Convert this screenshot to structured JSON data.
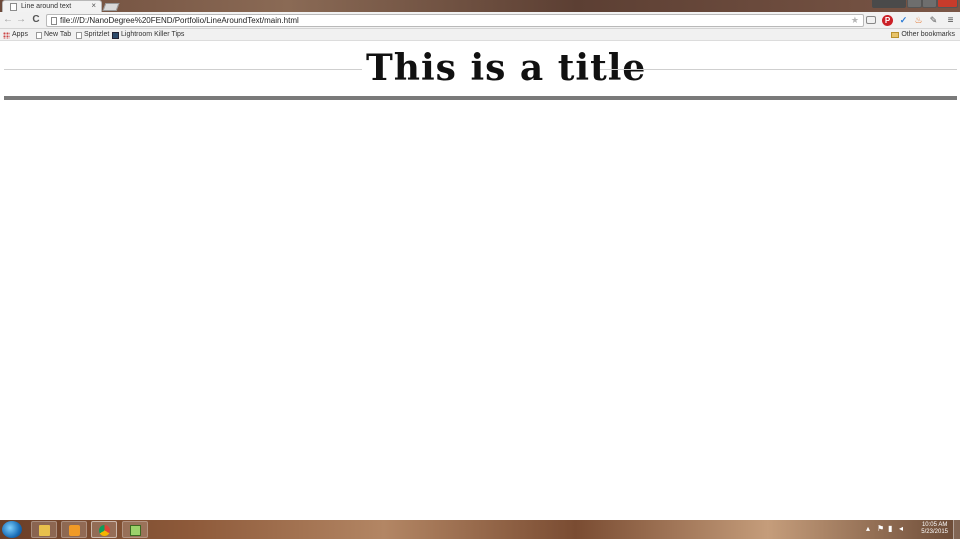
{
  "browser": {
    "tab": {
      "title": "Line around text",
      "close_glyph": "×"
    },
    "toolbar": {
      "back_glyph": "←",
      "forward_glyph": "→",
      "reload_glyph": "C",
      "url": "file:///D:/NanoDegree%20FEND/Portfolio/LineAroundText/main.html",
      "star_glyph": "★",
      "menu_glyph": "≡",
      "extensions": [
        {
          "name": "cast-icon",
          "glyph": "▭"
        },
        {
          "name": "pinterest-icon",
          "glyph": "P"
        },
        {
          "name": "checkmark-icon",
          "glyph": "✓"
        },
        {
          "name": "fire-icon",
          "glyph": "♨"
        },
        {
          "name": "puzzle-icon",
          "glyph": "✎"
        }
      ]
    },
    "bookmarks": [
      {
        "label": "Apps",
        "icon": "apps-grid-icon"
      },
      {
        "label": "New Tab",
        "icon": "page-icon"
      },
      {
        "label": "Spritzlet",
        "icon": "page-icon"
      },
      {
        "label": "Lightroom Killer Tips",
        "icon": "lightroom-icon"
      }
    ],
    "other_bookmarks": "Other bookmarks"
  },
  "page": {
    "title": "This is a title"
  },
  "taskbar": {
    "apps": [
      {
        "name": "file-explorer-icon"
      },
      {
        "name": "media-player-icon"
      },
      {
        "name": "chrome-icon"
      },
      {
        "name": "notepad-icon"
      }
    ],
    "clock": {
      "time": "10:05 AM",
      "date": "5/23/2015"
    }
  }
}
